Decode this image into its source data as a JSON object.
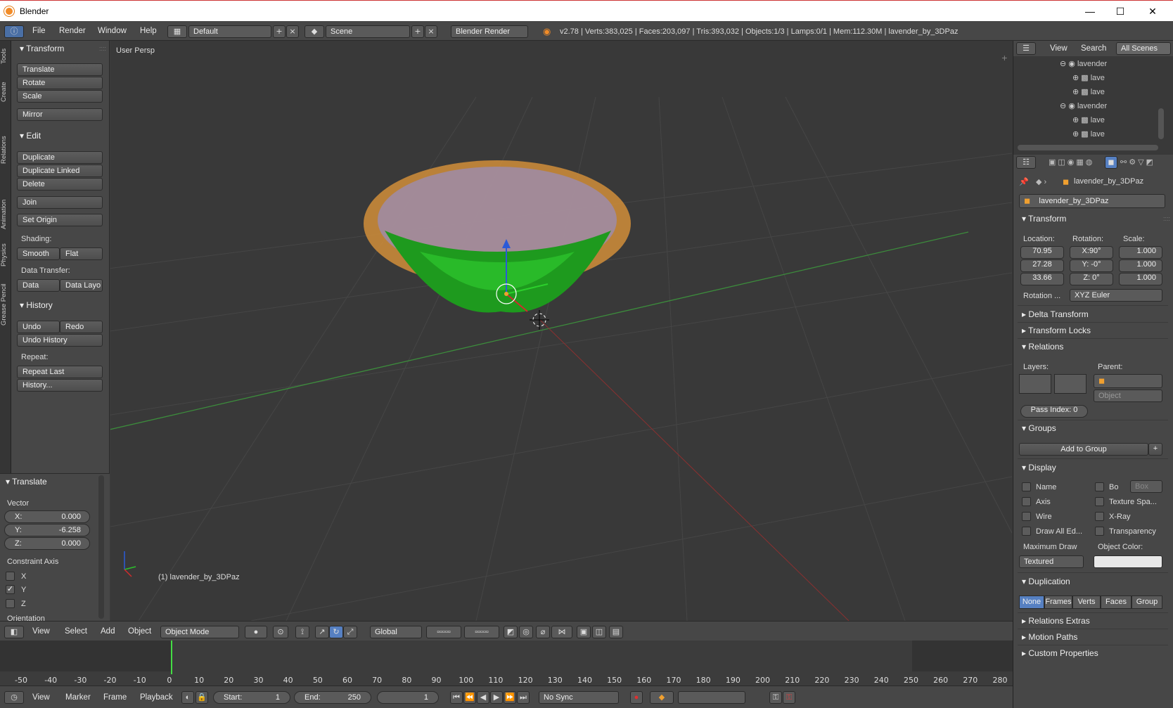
{
  "window": {
    "app_title": "Blender",
    "min": "—",
    "max": "☐",
    "close": "✕"
  },
  "info_bar": {
    "menus": [
      "File",
      "Render",
      "Window",
      "Help"
    ],
    "layout": "Default",
    "scene": "Scene",
    "engine": "Blender Render",
    "stats": "v2.78 | Verts:383,025 | Faces:203,097 | Tris:393,032 | Objects:1/3 | Lamps:0/1 | Mem:112.30M | lavender_by_3DPaz"
  },
  "side_tabs": [
    "Tools",
    "Create",
    "Relations",
    "Animation",
    "Physics",
    "Grease Pencil"
  ],
  "tools": {
    "transform": {
      "title": "Transform",
      "buttons": [
        "Translate",
        "Rotate",
        "Scale"
      ],
      "mirror": "Mirror"
    },
    "edit": {
      "title": "Edit",
      "buttons": [
        "Duplicate",
        "Duplicate Linked",
        "Delete"
      ],
      "join": "Join",
      "set_origin": "Set Origin",
      "shading_label": "Shading:",
      "smooth": "Smooth",
      "flat": "Flat",
      "data_transfer_label": "Data Transfer:",
      "data": "Data",
      "data_layo": "Data Layo"
    },
    "history": {
      "title": "History",
      "undo": "Undo",
      "redo": "Redo",
      "undo_history": "Undo History",
      "repeat_label": "Repeat:",
      "repeat_last": "Repeat Last",
      "history": "History..."
    }
  },
  "operator": {
    "title": "Translate",
    "vector_label": "Vector",
    "x": "X:",
    "x_val": "0.000",
    "y": "Y:",
    "y_val": "-6.258",
    "z": "Z:",
    "z_val": "0.000",
    "constraint_label": "Constraint Axis",
    "cx": "X",
    "cy": "Y",
    "cz": "Z",
    "cy_checked": "✓",
    "orientation": "Orientation"
  },
  "viewport": {
    "view_name": "User Persp",
    "object_label": "(1) lavender_by_3DPaz"
  },
  "viewport_header": {
    "menus": [
      "View",
      "Select",
      "Add",
      "Object"
    ],
    "mode": "Object Mode",
    "orientation": "Global"
  },
  "timeline": {
    "ticks": [
      "-50",
      "-40",
      "-30",
      "-20",
      "-10",
      "0",
      "10",
      "20",
      "30",
      "40",
      "50",
      "60",
      "70",
      "80",
      "90",
      "100",
      "110",
      "120",
      "130",
      "140",
      "150",
      "160",
      "170",
      "180",
      "190",
      "200",
      "210",
      "220",
      "230",
      "240",
      "250",
      "260",
      "270",
      "280"
    ],
    "menus": [
      "View",
      "Marker",
      "Frame",
      "Playback"
    ],
    "start_label": "Start:",
    "start": "1",
    "end_label": "End:",
    "end": "250",
    "current": "1",
    "sync": "No Sync"
  },
  "outliner": {
    "view": "View",
    "search": "Search",
    "all_scenes": "All Scenes",
    "rows": [
      "lavender",
      "lave",
      "lave",
      "lavender",
      "lave",
      "lave"
    ]
  },
  "props": {
    "object_path": "lavender_by_3DPaz",
    "object_name": "lavender_by_3DPaz",
    "transform": {
      "title": "Transform",
      "location_label": "Location:",
      "rotation_label": "Rotation:",
      "scale_label": "Scale:",
      "location": [
        "70.95",
        "27.28",
        "33.66"
      ],
      "rotation": [
        "X:90°",
        "Y: -0°",
        "Z: 0°"
      ],
      "scale": [
        "1.000",
        "1.000",
        "1.000"
      ],
      "rotation_mode_label": "Rotation ...",
      "rotation_mode": "XYZ Euler"
    },
    "delta_transform": "Delta Transform",
    "transform_locks": "Transform Locks",
    "relations": {
      "title": "Relations",
      "layers_label": "Layers:",
      "parent_label": "Parent:",
      "parent_type": "Object",
      "pass_index": "Pass Index:  0"
    },
    "groups": {
      "title": "Groups",
      "add": "Add to Group"
    },
    "display": {
      "title": "Display",
      "name": "Name",
      "bo": "Bo",
      "box": "Box",
      "axis": "Axis",
      "texture_space": "Texture Spa...",
      "wire": "Wire",
      "xray": "X-Ray",
      "draw_all": "Draw All Ed...",
      "transparency": "Transparency",
      "max_draw_label": "Maximum Draw",
      "object_color_label": "Object Color:",
      "max_draw": "Textured"
    },
    "duplication": {
      "title": "Duplication",
      "options": [
        "None",
        "Frames",
        "Verts",
        "Faces",
        "Group"
      ]
    },
    "relations_extras": "Relations Extras",
    "motion_paths": "Motion Paths",
    "custom_properties": "Custom Properties"
  },
  "colors": {
    "accent_blue": "#5680c2",
    "bg": "#393939",
    "panel": "#474747",
    "selected_orange": "#f0a030",
    "frame_green": "#44dd44"
  }
}
